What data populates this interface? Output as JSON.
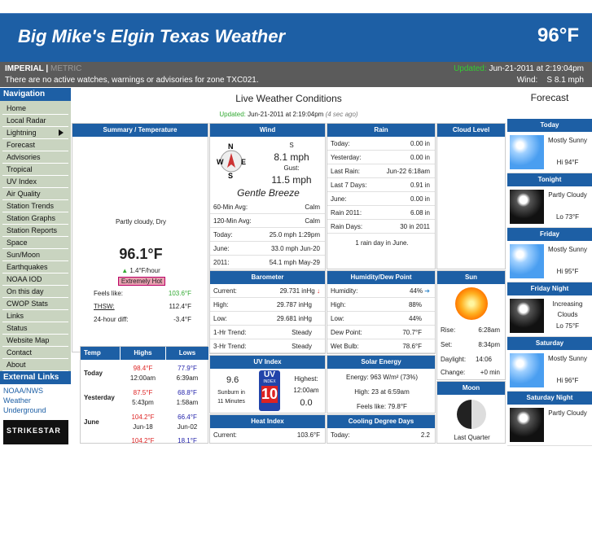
{
  "header": {
    "title": "Big Mike's Elgin Texas Weather",
    "temp": "96°F"
  },
  "bar": {
    "imperial": "IMPERIAL",
    "sep": "|",
    "metric": "METRIC",
    "advisory": "There are no active watches, warnings or advisories for zone TXC021.",
    "updated_label": "Updated:",
    "updated_time": "Jun-21-2011 at 2:19:04pm",
    "wind_label": "Wind:",
    "wind_value": "S 8.1 mph"
  },
  "nav": {
    "heading": "Navigation",
    "items": [
      "Home",
      "Local Radar",
      "Lightning",
      "Forecast",
      "Advisories",
      "Tropical",
      "UV Index",
      "Air Quality",
      "Station Trends",
      "Station Graphs",
      "Station Reports",
      "Space",
      "Sun/Moon",
      "Earthquakes",
      "NOAA IOD",
      "On this day",
      "CWOP Stats",
      "Links",
      "Status",
      "Website Map",
      "Contact",
      "About"
    ],
    "ext_heading": "External Links",
    "ext_links": [
      "NOAA/NWS",
      "Weather Underground"
    ],
    "logo": "STRIKESTAR"
  },
  "main": {
    "title": "Live Weather Conditions",
    "updated_label": "Updated:",
    "updated_time": "Jun-21-2011 at 2:19:04pm",
    "updated_ago": "(4 sec ago)",
    "summary": {
      "heading": "Summary / Temperature",
      "condition": "Partly cloudy, Dry",
      "temp": "96.1°F",
      "rate": "1.4°F/hour",
      "badge": "Extremely Hot",
      "rows": [
        [
          "Feels like:",
          "103.6°F"
        ],
        [
          "THSW:",
          "112.4°F"
        ],
        [
          "24-hour diff:",
          "-3.4°F"
        ]
      ]
    },
    "wind": {
      "heading": "Wind",
      "dir": "S",
      "speed": "8.1 mph",
      "gust_label": "Gust:",
      "gust": "11.5 mph",
      "desc": "Gentle Breeze",
      "compass": [
        "N",
        "S",
        "W",
        "E"
      ],
      "rows": [
        [
          "60-Min Avg:",
          "Calm"
        ],
        [
          "120-Min Avg:",
          "Calm"
        ],
        [
          "Today:",
          "25.0 mph 1:29pm"
        ],
        [
          "June:",
          "33.0 mph Jun-20"
        ],
        [
          "2011:",
          "54.1 mph May-29"
        ]
      ]
    },
    "rain": {
      "heading": "Rain",
      "rows": [
        [
          "Today:",
          "0.00 in"
        ],
        [
          "Yesterday:",
          "0.00 in"
        ],
        [
          "Last Rain:",
          "Jun-22 6:18am"
        ],
        [
          "Last 7 Days:",
          "0.91 in"
        ],
        [
          "June:",
          "0.00 in"
        ],
        [
          "Rain 2011:",
          "6.08 in"
        ],
        [
          "Rain Days:",
          "30 in 2011"
        ]
      ],
      "note": "1 rain day in June."
    },
    "cloud": {
      "heading": "Cloud Level"
    },
    "baro": {
      "heading": "Barometer",
      "rows": [
        [
          "Current:",
          "29.731 inHg"
        ],
        [
          "High:",
          "29.787 inHg"
        ],
        [
          "Low:",
          "29.681 inHg"
        ],
        [
          "1-Hr Trend:",
          "Steady"
        ],
        [
          "3-Hr Trend:",
          "Steady"
        ]
      ]
    },
    "hum": {
      "heading": "Humidity/Dew Point",
      "rows": [
        [
          "Humidity:",
          "44%"
        ],
        [
          "High:",
          "88%"
        ],
        [
          "Low:",
          "44%"
        ],
        [
          "Dew Point:",
          "70.7°F"
        ],
        [
          "Wet Bulb:",
          "78.6°F"
        ]
      ]
    },
    "sun": {
      "heading": "Sun",
      "rows": [
        [
          "Rise:",
          "6:28am"
        ],
        [
          "Set:",
          "8:34pm"
        ],
        [
          "Daylight:",
          "14:06"
        ],
        [
          "Change:",
          "+0 min"
        ]
      ]
    },
    "temps": {
      "headings": [
        "Temp",
        "Highs",
        "Lows"
      ],
      "rows": [
        {
          "label": "Today",
          "hi": "98.4°F",
          "hi_t": "12:00am",
          "lo": "77.9°F",
          "lo_t": "6:39am"
        },
        {
          "label": "Yesterday",
          "hi": "87.5°F",
          "hi_t": "5:43pm",
          "lo": "68.8°F",
          "lo_t": "1:58am"
        },
        {
          "label": "June",
          "hi": "104.2°F",
          "hi_t": "Jun-18",
          "lo": "66.4°F",
          "lo_t": "Jun-02"
        },
        {
          "label": "",
          "hi": "104.2°F",
          "hi_t": "",
          "lo": "18.1°F",
          "lo_t": ""
        }
      ]
    },
    "uv": {
      "heading": "UV Index",
      "value": "9.6",
      "burn": "Sunburn in 11 Minutes",
      "badge_top": "UV",
      "badge_mid": "INDEX",
      "badge_num": "10",
      "highest_label": "Highest:",
      "highest_time": "12:00am",
      "current": "0.0"
    },
    "solar": {
      "heading": "Solar Energy",
      "energy": "Energy: 963 W/m² (73%)",
      "high": "High: 23 at 6:59am",
      "feels": "Feels like: 79.8°F"
    },
    "moon": {
      "heading": "Moon",
      "phase": "Last Quarter"
    },
    "heat": {
      "heading": "Heat Index",
      "current_label": "Current:",
      "current": "103.6°F"
    },
    "cool": {
      "heading": "Cooling Degree Days",
      "today_label": "Today:",
      "today": "2.2"
    }
  },
  "forecast": {
    "title": "Forecast",
    "days": [
      {
        "name": "Today",
        "text": "Mostly Sunny",
        "temp": "Hi 94°F",
        "icon": "sunny"
      },
      {
        "name": "Tonight",
        "text": "Partly Cloudy",
        "temp": "Lo 73°F",
        "icon": "night"
      },
      {
        "name": "Friday",
        "text": "Mostly Sunny",
        "temp": "Hi 95°F",
        "icon": "sunny"
      },
      {
        "name": "Friday Night",
        "text": "Increasing Clouds",
        "temp": "Lo 75°F",
        "icon": "night"
      },
      {
        "name": "Saturday",
        "text": "Mostly Sunny",
        "temp": "Hi 96°F",
        "icon": "sunny"
      },
      {
        "name": "Saturday Night",
        "text": "Partly Cloudy",
        "temp": "",
        "icon": "night"
      }
    ]
  }
}
